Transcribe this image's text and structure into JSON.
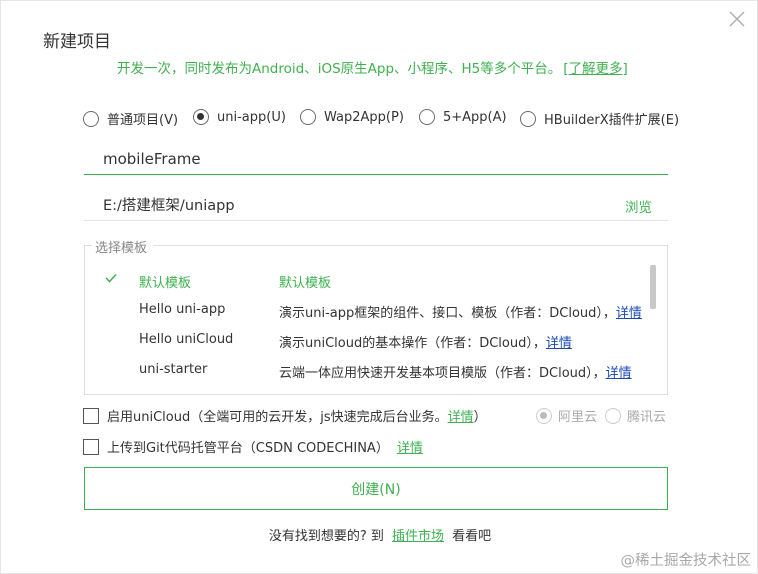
{
  "dialog": {
    "title": "新建项目",
    "subtitle": "开发一次，同时发布为Android、iOS原生App、小程序、H5等多个平台。",
    "subtitle_link": "[了解更多]"
  },
  "project_types": [
    {
      "label": "普通项目(V)",
      "checked": false
    },
    {
      "label": "uni-app(U)",
      "checked": true
    },
    {
      "label": "Wap2App(P)",
      "checked": false
    },
    {
      "label": "5+App(A)",
      "checked": false
    },
    {
      "label": "HBuilderX插件扩展(E)",
      "checked": false
    }
  ],
  "project_name": {
    "value": "mobileFrame"
  },
  "project_path": {
    "value": "E:/搭建框架/uniapp",
    "browse_label": "浏览"
  },
  "templates": {
    "legend": "选择模板",
    "rows": [
      {
        "name": "默认模板",
        "desc": "默认模板",
        "detail": "",
        "selected": true
      },
      {
        "name": "Hello uni-app",
        "desc": "演示uni-app框架的组件、接口、模板（作者：DCloud），",
        "detail": "详情",
        "selected": false
      },
      {
        "name": "Hello uniCloud",
        "desc": "演示uniCloud的基本操作（作者：DCloud），",
        "detail": "详情",
        "selected": false
      },
      {
        "name": "uni-starter",
        "desc": "云端一体应用快速开发基本项目模版（作者：DCloud），",
        "detail": "详情",
        "selected": false
      }
    ]
  },
  "unicloud": {
    "label": "启用uniCloud（全端可用的云开发，js快速完成后台业务。",
    "link": "详情",
    "close_paren": "）",
    "providers": [
      {
        "label": "阿里云",
        "checked": true
      },
      {
        "label": "腾讯云",
        "checked": false
      }
    ]
  },
  "git": {
    "label": "上传到Git代码托管平台（CSDN CODECHINA）",
    "link": "详情"
  },
  "create_button": "创建(N)",
  "footer": {
    "prefix": "没有找到想要的? 到",
    "link": "插件市场",
    "suffix": "看看吧"
  },
  "watermark": "@稀土掘金技术社区",
  "colors": {
    "accent": "#3fb150",
    "link_blue": "#1a4ab8"
  }
}
